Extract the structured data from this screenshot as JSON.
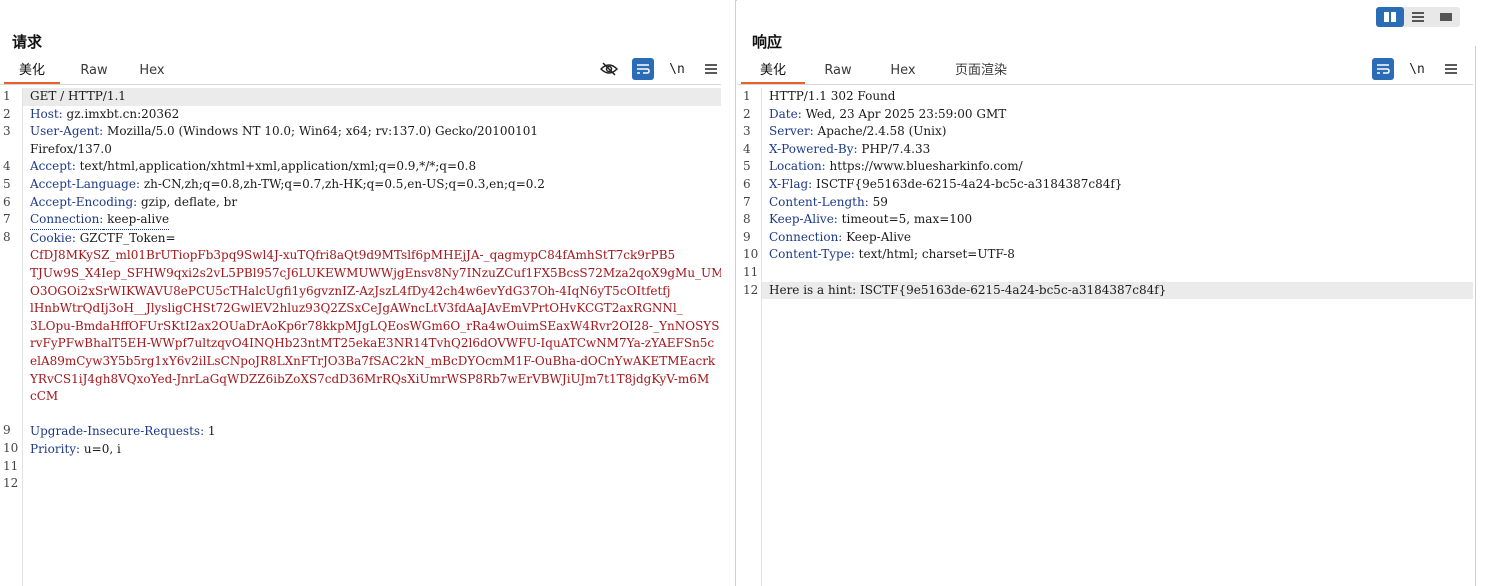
{
  "request": {
    "title": "请求",
    "tabs": [
      "美化",
      "Raw",
      "Hex"
    ],
    "active_tab": 0,
    "toolbar_icons": [
      "hide-icon",
      "wrap-icon",
      "newline-icon",
      "menu-icon"
    ],
    "newline_label": "\\n",
    "lines": [
      {
        "n": "1",
        "name": "",
        "value": "GET / HTTP/1.1",
        "kind": "reqline"
      },
      {
        "n": "2",
        "name": "Host:",
        "value": " gz.imxbt.cn:20362",
        "kind": "header"
      },
      {
        "n": "3",
        "name": "User-Agent:",
        "value": " Mozilla/5.0 (Windows NT 10.0; Win64; x64; rv:137.0) Gecko/20100101",
        "kind": "header"
      },
      {
        "n": "",
        "name": "",
        "value": "Firefox/137.0",
        "kind": "cont"
      },
      {
        "n": "4",
        "name": "Accept:",
        "value": " text/html,application/xhtml+xml,application/xml;q=0.9,*/*;q=0.8",
        "kind": "header"
      },
      {
        "n": "5",
        "name": "Accept-Language:",
        "value": " zh-CN,zh;q=0.8,zh-TW;q=0.7,zh-HK;q=0.5,en-US;q=0.3,en;q=0.2",
        "kind": "header"
      },
      {
        "n": "6",
        "name": "Accept-Encoding:",
        "value": " gzip, deflate, br",
        "kind": "header"
      },
      {
        "n": "7",
        "name": "Connection:",
        "value": " keep-alive",
        "kind": "dotted"
      },
      {
        "n": "8",
        "name": "Cookie:",
        "value": " GZCTF_Token=",
        "kind": "header"
      },
      {
        "n": "",
        "name": "",
        "value": "CfDJ8MKySZ_ml01BrUTiopFb3pq9Swl4J-xuTQfri8aQt9d9MTslf6pMHEjJA-_qagmypC84fAmhStT7ck9rPB5",
        "kind": "cookie"
      },
      {
        "n": "",
        "name": "",
        "value": "TJUw9S_X4Iep_SFHW9qxi2s2vL5PBl957cJ6LUKEWMUWWjgEnsv8Ny7INzuZCuf1FX5BcsS72Mza2qoX9gMu_UM",
        "kind": "cookie"
      },
      {
        "n": "",
        "name": "",
        "value": "O3OGOi2xSrWIKWAVU8ePCU5cTHalcUgfi1y6gvznIZ-AzJszL4fDy42ch4w6evYdG37Oh-4IqN6yT5cOItfetfj",
        "kind": "cookie"
      },
      {
        "n": "",
        "name": "",
        "value": "lHnbWtrQdIj3oH__JlysligCHSt72GwlEV2hluz93Q2ZSxCeJgAWncLtV3fdAaJAvEmVPrtOHvKCGT2axRGNNl_",
        "kind": "cookie"
      },
      {
        "n": "",
        "name": "",
        "value": "3LOpu-BmdaHffOFUrSKtI2ax2OUaDrAoKp6r78kkpMJgLQEosWGm6O_rRa4wOuimSEaxW4Rvr2OI28-_YnNOSYS",
        "kind": "cookie"
      },
      {
        "n": "",
        "name": "",
        "value": "rvFyPFwBhalT5EH-WWpf7ultzqvO4INQHb23ntMT25ekaE3NR14TvhQ2l6dOVWFU-IquATCwNM7Ya-zYAEFSn5c",
        "kind": "cookie"
      },
      {
        "n": "",
        "name": "",
        "value": "elA89mCyw3Y5b5rg1xY6v2ilLsCNpoJR8LXnFTrJO3Ba7fSAC2kN_mBcDYOcmM1F-OuBha-dOCnYwAKETMEacrk",
        "kind": "cookie"
      },
      {
        "n": "",
        "name": "",
        "value": "YRvCS1iJ4gh8VQxoYed-JnrLaGqWDZZ6ibZoXS7cdD36MrRQsXiUmrWSP8Rb7wErVBWJiUJm7t1T8jdgKyV-m6M",
        "kind": "cookie"
      },
      {
        "n": "",
        "name": "",
        "value": "cCM",
        "kind": "cookie"
      },
      {
        "n": "",
        "name": "",
        "value": "",
        "kind": "blank"
      },
      {
        "n": "9",
        "name": "Upgrade-Insecure-Requests:",
        "value": " 1",
        "kind": "header"
      },
      {
        "n": "10",
        "name": "Priority:",
        "value": " u=0, i",
        "kind": "header"
      },
      {
        "n": "11",
        "name": "",
        "value": "",
        "kind": "blank"
      },
      {
        "n": "12",
        "name": "",
        "value": "",
        "kind": "blank"
      }
    ]
  },
  "response": {
    "title": "响应",
    "tabs": [
      "美化",
      "Raw",
      "Hex",
      "页面渲染"
    ],
    "active_tab": 0,
    "toolbar_icons": [
      "wrap-icon",
      "newline-icon",
      "menu-icon"
    ],
    "newline_label": "\\n",
    "lines": [
      {
        "n": "1",
        "name": "",
        "value": "HTTP/1.1 302 Found",
        "kind": "reqline"
      },
      {
        "n": "2",
        "name": "Date:",
        "value": " Wed, 23 Apr 2025 23:59:00 GMT",
        "kind": "header"
      },
      {
        "n": "3",
        "name": "Server:",
        "value": " Apache/2.4.58 (Unix)",
        "kind": "header"
      },
      {
        "n": "4",
        "name": "X-Powered-By:",
        "value": " PHP/7.4.33",
        "kind": "header"
      },
      {
        "n": "5",
        "name": "Location:",
        "value": " https://www.bluesharkinfo.com/",
        "kind": "header"
      },
      {
        "n": "6",
        "name": "X-Flag:",
        "value": " ISCTF{9e5163de-6215-4a24-bc5c-a3184387c84f}",
        "kind": "header"
      },
      {
        "n": "7",
        "name": "Content-Length:",
        "value": " 59",
        "kind": "header"
      },
      {
        "n": "8",
        "name": "Keep-Alive:",
        "value": " timeout=5, max=100",
        "kind": "header"
      },
      {
        "n": "9",
        "name": "Connection:",
        "value": " Keep-Alive",
        "kind": "header"
      },
      {
        "n": "10",
        "name": "Content-Type:",
        "value": " text/html; charset=UTF-8",
        "kind": "header"
      },
      {
        "n": "11",
        "name": "",
        "value": "",
        "kind": "blank"
      },
      {
        "n": "12",
        "name": "",
        "value": "Here is a hint: ISCTF{9e5163de-6215-4a24-bc5c-a3184387c84f}",
        "kind": "body"
      }
    ]
  },
  "layout_switch": {
    "buttons": [
      "split-vertical-icon",
      "split-horizontal-icon",
      "single-pane-icon"
    ],
    "active": 0
  },
  "colors": {
    "accent_tab": "#e8612c",
    "active_icon_bg": "#2a6cb6",
    "header_name": "#1d3a8a",
    "cookie_value": "#a3161b"
  }
}
